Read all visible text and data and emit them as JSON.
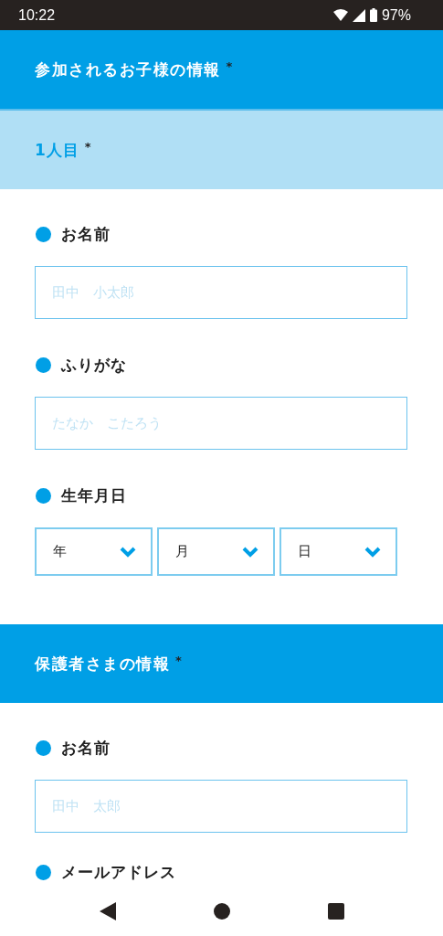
{
  "status_bar": {
    "time": "10:22",
    "battery": "97%"
  },
  "blocks": [
    {
      "kind": "header",
      "title": "参加されるお子様の情報",
      "mark": "*"
    },
    {
      "kind": "subheader",
      "title": "1人目",
      "mark": "*"
    },
    {
      "kind": "text",
      "label": "お名前",
      "placeholder": "田中　小太郎"
    },
    {
      "kind": "text",
      "label": "ふりがな",
      "placeholder": "たなか　こたろう"
    },
    {
      "kind": "date",
      "label": "生年月日",
      "selects": [
        "年",
        "月",
        "日"
      ]
    },
    {
      "kind": "header",
      "title": "保護者さまの情報",
      "mark": "*"
    },
    {
      "kind": "text",
      "label": "お名前",
      "placeholder": "田中　太郎"
    },
    {
      "kind": "label",
      "label": "メールアドレス"
    }
  ]
}
